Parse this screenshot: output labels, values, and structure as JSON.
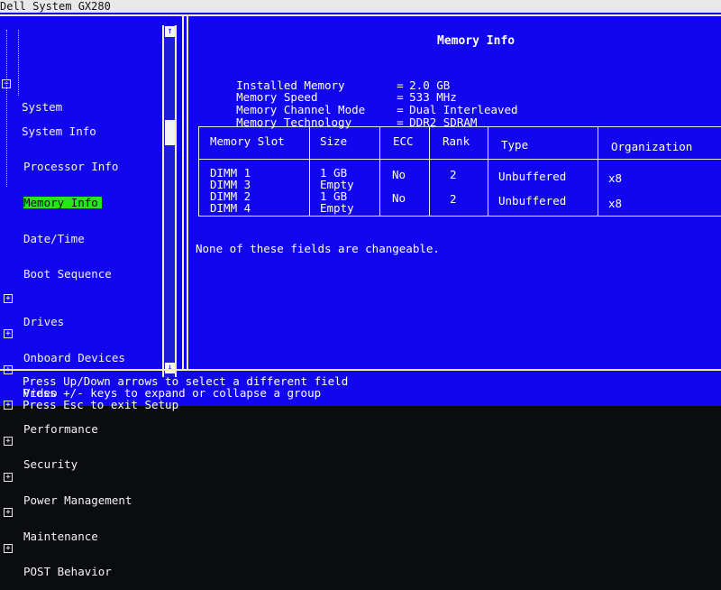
{
  "window_title": "Dell System GX280",
  "colors": {
    "background": "#1206ee",
    "frame": "#f2f0a8",
    "selection": "#22e81c",
    "text": "#ffffff"
  },
  "tree": [
    {
      "label": "System",
      "expanded": true,
      "selected": false,
      "level": 0
    },
    {
      "label": "System Info",
      "selected": false,
      "level": 1
    },
    {
      "label": "Processor Info",
      "selected": false,
      "level": 1
    },
    {
      "label": "Memory Info",
      "selected": true,
      "level": 1
    },
    {
      "label": "Date/Time",
      "selected": false,
      "level": 1
    },
    {
      "label": "Boot Sequence",
      "selected": false,
      "level": 1
    },
    {
      "label": "Drives",
      "expanded": false,
      "selected": false,
      "level": 0
    },
    {
      "label": "Onboard Devices",
      "expanded": false,
      "selected": false,
      "level": 0
    },
    {
      "label": "Video",
      "expanded": false,
      "selected": false,
      "level": 0
    },
    {
      "label": "Performance",
      "expanded": false,
      "selected": false,
      "level": 0
    },
    {
      "label": "Security",
      "expanded": false,
      "selected": false,
      "level": 0
    },
    {
      "label": "Power Management",
      "expanded": false,
      "selected": false,
      "level": 0
    },
    {
      "label": "Maintenance",
      "expanded": false,
      "selected": false,
      "level": 0
    },
    {
      "label": "POST Behavior",
      "expanded": false,
      "selected": false,
      "level": 0
    }
  ],
  "scrollbar": {
    "up": "↑",
    "down": "↓"
  },
  "panel": {
    "title": "Memory Info",
    "fields": [
      {
        "label": "Installed Memory",
        "value": "2.0 GB"
      },
      {
        "label": "Memory Speed",
        "value": "533 MHz"
      },
      {
        "label": "Memory Channel Mode",
        "value": "Dual Interleaved"
      },
      {
        "label": "Memory Technology",
        "value": "DDR2 SDRAM"
      }
    ],
    "equals": "=",
    "table": {
      "headers": [
        "Memory Slot",
        "Size",
        "ECC",
        "Rank",
        "Type",
        "Organization"
      ],
      "rows": [
        {
          "slot_a": "DIMM 1",
          "slot_b": "DIMM 3",
          "size_a": "1 GB",
          "size_b": "Empty",
          "ecc": "No",
          "rank": "2",
          "type": "Unbuffered",
          "org": "x8"
        },
        {
          "slot_a": "DIMM 2",
          "slot_b": "DIMM 4",
          "size_a": "1 GB",
          "size_b": "Empty",
          "ecc": "No",
          "rank": "2",
          "type": "Unbuffered",
          "org": "x8"
        }
      ]
    },
    "note": "None of these fields are changeable."
  },
  "help": [
    "Press Up/Down arrows to select a different field",
    "Press +/- keys to expand or collapse a group",
    "Press Esc to exit Setup"
  ]
}
